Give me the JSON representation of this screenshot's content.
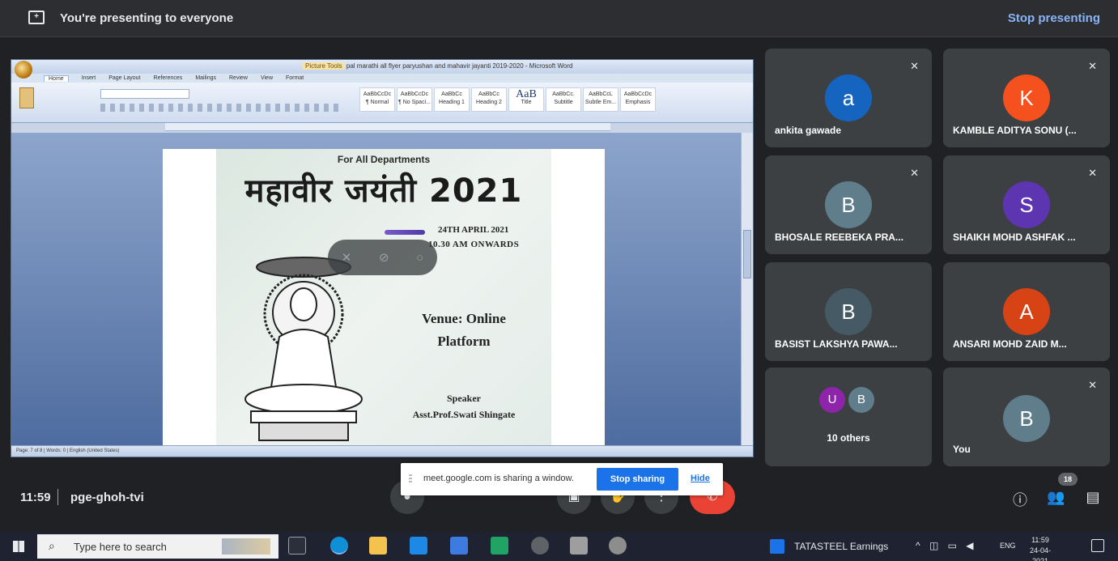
{
  "banner": {
    "message": "You're presenting to everyone",
    "stop_label": "Stop presenting"
  },
  "shared_window": {
    "contextual_tab": "Picture Tools",
    "title": "pal marathi all flyer paryushan and mahavir jayanti 2019-2020 - Microsoft Word",
    "tabs": [
      "Home",
      "Insert",
      "Page Layout",
      "References",
      "Mailings",
      "Review",
      "View",
      "Format"
    ],
    "styles": [
      {
        "sample": "AaBbCcDc",
        "name": "¶ Normal"
      },
      {
        "sample": "AaBbCcDc",
        "name": "¶ No Spaci..."
      },
      {
        "sample": "AaBbCc",
        "name": "Heading 1"
      },
      {
        "sample": "AaBbCc",
        "name": "Heading 2"
      },
      {
        "sample": "AaB",
        "name": "Title"
      },
      {
        "sample": "AaBbCc.",
        "name": "Subtitle"
      },
      {
        "sample": "AaBbCcL",
        "name": "Subtle Em..."
      },
      {
        "sample": "AaBbCcDc",
        "name": "Emphasis"
      }
    ],
    "status": "Page: 7 of 8  |  Words: 0  |  English (United States)",
    "poster": {
      "dept": "For All Departments",
      "hindi_title": "महावीर जयंती 2021",
      "date": "24TH APRIL 2021",
      "time": "10.30 AM  ONWARDS",
      "venue_line1": "Venue: Online",
      "venue_line2": "Platform",
      "speaker_label": "Speaker",
      "speaker_name": "Asst.Prof.Swati Shingate"
    }
  },
  "participants": [
    {
      "initial": "a",
      "name": "ankita gawade",
      "color": "#1565c0",
      "muted": true
    },
    {
      "initial": "K",
      "name": "KAMBLE ADITYA SONU (...",
      "color": "#f4511e",
      "muted": true
    },
    {
      "initial": "B",
      "name": "BHOSALE REEBEKA PRA...",
      "color": "#607d8b",
      "muted": true
    },
    {
      "initial": "S",
      "name": "SHAIKH MOHD ASHFAK ...",
      "color": "#5e35b1",
      "muted": true
    },
    {
      "initial": "B",
      "name": "BASIST LAKSHYA PAWA...",
      "color": "#455a64",
      "muted": false
    },
    {
      "initial": "A",
      "name": "ANSARI MOHD ZAID M...",
      "color": "#d84315",
      "muted": false
    }
  ],
  "others_tile": {
    "initials": [
      "U",
      "B"
    ],
    "colors": [
      "#8e24aa",
      "#607d8b"
    ],
    "label": "10 others"
  },
  "you_tile": {
    "initial": "B",
    "label": "You",
    "color": "#607d8b"
  },
  "bottom_bar": {
    "time": "11:59",
    "meeting_code": "pge-ghoh-tvi",
    "participant_count": "18"
  },
  "share_notice": {
    "text": "meet.google.com is sharing a window.",
    "stop_label": "Stop sharing",
    "hide_label": "Hide"
  },
  "taskbar": {
    "search_placeholder": "Type here to search",
    "news_text": "TATASTEEL  Earnings",
    "lang": "ENG",
    "clock_time": "11:59",
    "clock_date": "24-04-2021"
  }
}
